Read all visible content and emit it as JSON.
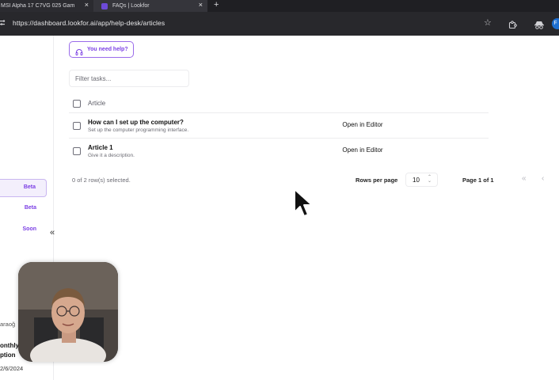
{
  "browser": {
    "tabs": [
      {
        "title": "MSI Alpha 17 C7VG 025 Gam"
      },
      {
        "title": "FAQs | Lookfor"
      }
    ],
    "new_tab": "+",
    "url": "https://dashboard.lookfor.ai/app/help-desk/articles",
    "profile_initial": "F"
  },
  "sidebar": {
    "items": [
      {
        "badge": "Beta",
        "active": true
      },
      {
        "badge": "Beta",
        "active": false
      },
      {
        "badge": "Soon",
        "active": false
      }
    ],
    "collapse_icon": "«",
    "user_name": "araoğ",
    "plan_line1": "onthly",
    "plan_line2": "ption",
    "date": "2/6/2024"
  },
  "main": {
    "help_button": "You need help?",
    "filter_placeholder": "Filter tasks...",
    "table": {
      "header": "Article",
      "rows": [
        {
          "title": "How can I set up the computer?",
          "description": "Set up the computer programming interface.",
          "action": "Open in Editor"
        },
        {
          "title": "Article 1",
          "description": "Give it a description.",
          "action": "Open in Editor"
        }
      ]
    },
    "selection_status": "0 of 2 row(s) selected.",
    "rows_per_page_label": "Rows per page",
    "rows_per_page_value": "10",
    "page_info": "Page 1 of 1"
  },
  "colors": {
    "accent": "#7b3fe4",
    "accent_border": "#9a6bea",
    "chrome_dark": "#28282c"
  }
}
